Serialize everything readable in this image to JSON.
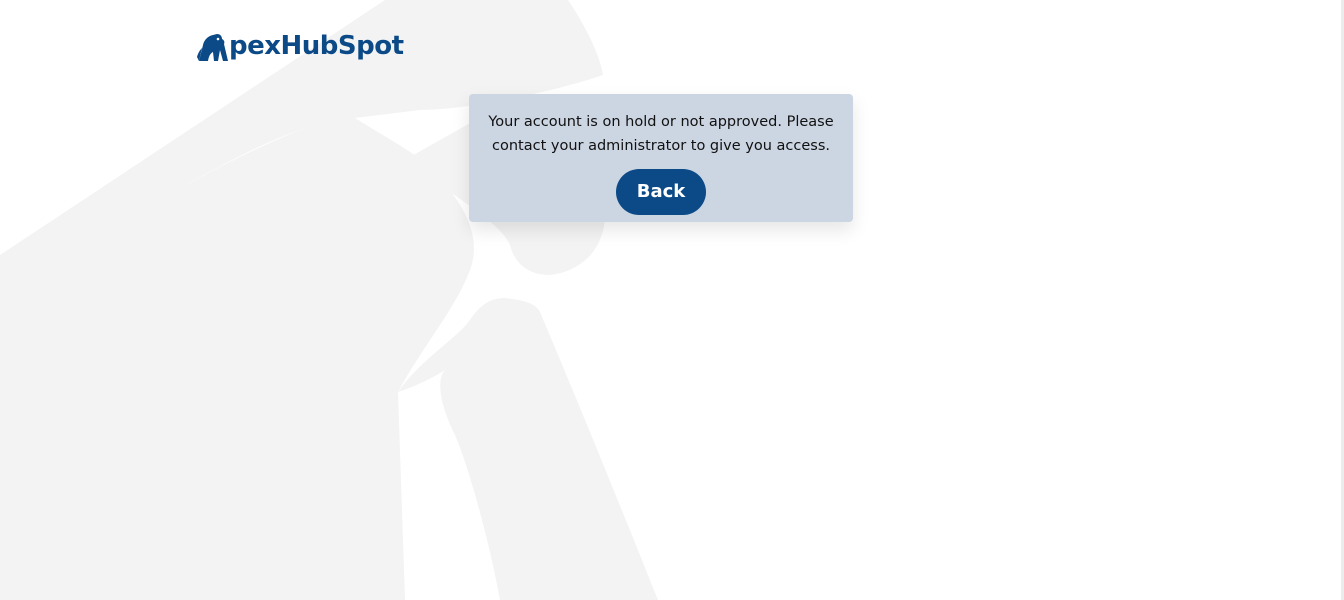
{
  "brand": {
    "logo_text": "pexHubSpot",
    "logo_icon": "gorilla-a-icon",
    "brand_color": "#0b4a86"
  },
  "notice": {
    "message": "Your account is on hold or not approved. Please contact your administrator to give you access.",
    "background_color": "#ccd5e2"
  },
  "actions": {
    "back_label": "Back"
  },
  "background": {
    "watermark_icon": "gorilla-watermark-icon",
    "watermark_color": "#f3f3f3"
  }
}
